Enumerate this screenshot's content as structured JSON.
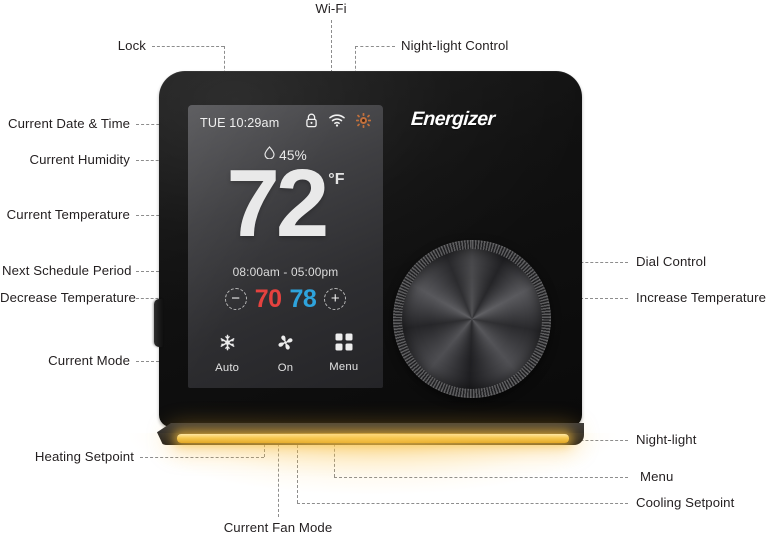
{
  "device": {
    "brand": "Energizer",
    "screen": {
      "status_bar": {
        "datetime": "TUE 10:29am",
        "icons": [
          {
            "name": "lock-icon",
            "label": "Lock",
            "color": "#ffffff"
          },
          {
            "name": "wifi-icon",
            "label": "Wi-Fi",
            "color": "#ffffff"
          },
          {
            "name": "night-light-icon",
            "label": "Night-light Control",
            "color": "#c2703c"
          }
        ]
      },
      "humidity": "45%",
      "temperature": "72",
      "temperature_unit": "°F",
      "schedule_period": "08:00am - 05:00pm",
      "setpoints": {
        "decrease_symbol": "−",
        "increase_symbol": "+",
        "heating": "70",
        "cooling": "78",
        "heating_color": "#e5423f",
        "cooling_color": "#2ea3dc"
      },
      "mode_buttons": [
        {
          "name": "mode-auto",
          "label": "Auto",
          "icon": "auto-mode-icon"
        },
        {
          "name": "fan-on",
          "label": "On",
          "icon": "fan-icon"
        },
        {
          "name": "menu",
          "label": "Menu",
          "icon": "menu-grid-icon"
        }
      ]
    },
    "night_light_color": "#f6c84f"
  },
  "callouts": {
    "top": [
      {
        "name": "callout-wifi",
        "text": "Wi-Fi"
      },
      {
        "name": "callout-lock",
        "text": "Lock"
      },
      {
        "name": "callout-night-light-control",
        "text": "Night-light Control"
      }
    ],
    "left": [
      {
        "name": "callout-current-date-time",
        "text": "Current Date & Time"
      },
      {
        "name": "callout-current-humidity",
        "text": "Current Humidity"
      },
      {
        "name": "callout-current-temperature",
        "text": "Current Temperature"
      },
      {
        "name": "callout-next-schedule-period",
        "text": "Next Schedule Period"
      },
      {
        "name": "callout-decrease-temperature",
        "text": "Decrease Temperature"
      },
      {
        "name": "callout-current-mode",
        "text": "Current Mode"
      }
    ],
    "right": [
      {
        "name": "callout-dial-control",
        "text": "Dial Control"
      },
      {
        "name": "callout-increase-temperature",
        "text": "Increase Temperature"
      },
      {
        "name": "callout-night-light",
        "text": "Night-light"
      },
      {
        "name": "callout-menu",
        "text": "Menu"
      },
      {
        "name": "callout-cooling-setpoint",
        "text": "Cooling Setpoint"
      }
    ],
    "bottom": [
      {
        "name": "callout-heating-setpoint",
        "text": "Heating Setpoint"
      },
      {
        "name": "callout-current-fan-mode",
        "text": "Current Fan Mode"
      }
    ]
  }
}
